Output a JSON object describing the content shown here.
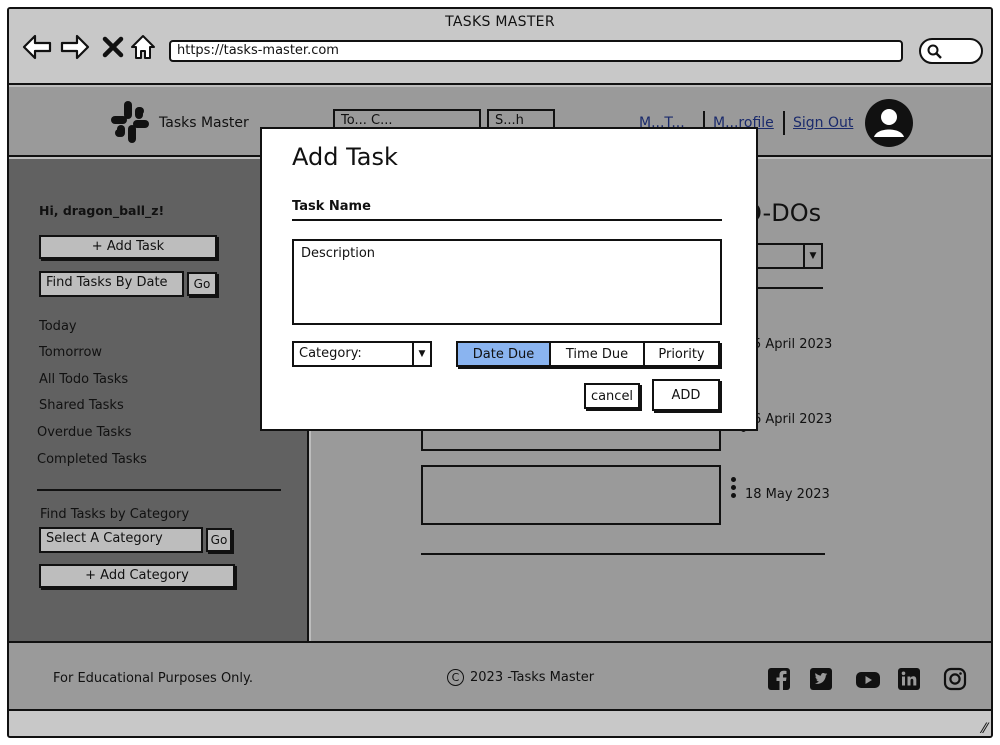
{
  "browser": {
    "window_title": "TASKS MASTER",
    "url": "https://tasks-master.com"
  },
  "header": {
    "brand": "Tasks Master",
    "category_select_partial": "To... C...",
    "search_partial": "S...h",
    "nav": {
      "my_tasks_partial": "M...T...",
      "my_profile_partial": "M...rofile",
      "sign_out": "Sign Out"
    }
  },
  "sidebar": {
    "greeting": "Hi, dragon_ball_z!",
    "add_task": "+ Add Task",
    "find_by_date_placeholder": "Find Tasks By Date",
    "go": "Go",
    "filters": [
      "Today",
      "Tomorrow",
      "All Todo Tasks",
      "Shared Tasks",
      "Overdue Tasks",
      "Completed Tasks"
    ],
    "find_by_category_label": "Find Tasks by Category",
    "category_select": "Select A Category",
    "add_category": "+ Add Category"
  },
  "main": {
    "title_partial": "O-DOs",
    "tasks": [
      {
        "date_partial": "5 April 2023"
      },
      {
        "date_partial": "6 April 2023"
      },
      {
        "date": "18 May 2023"
      }
    ]
  },
  "modal": {
    "title": "Add Task",
    "task_name_label": "Task Name",
    "description_placeholder": "Description",
    "category_placeholder": "Category:",
    "sort_options": [
      "Date Due",
      "Time Due",
      "Priority"
    ],
    "active_sort": "Date Due",
    "cancel": "cancel",
    "add": "ADD"
  },
  "footer": {
    "disclaimer": "For Educational Purposes Only.",
    "copyright": "2023 -Tasks Master",
    "social_icons": [
      "facebook-icon",
      "twitter-icon",
      "youtube-icon",
      "linkedin-icon",
      "instagram-icon"
    ]
  },
  "colors": {
    "active_segment": "#8ab4f0",
    "sidebar_bg": "#616161",
    "overlay_gray": "#9a9a9a"
  }
}
